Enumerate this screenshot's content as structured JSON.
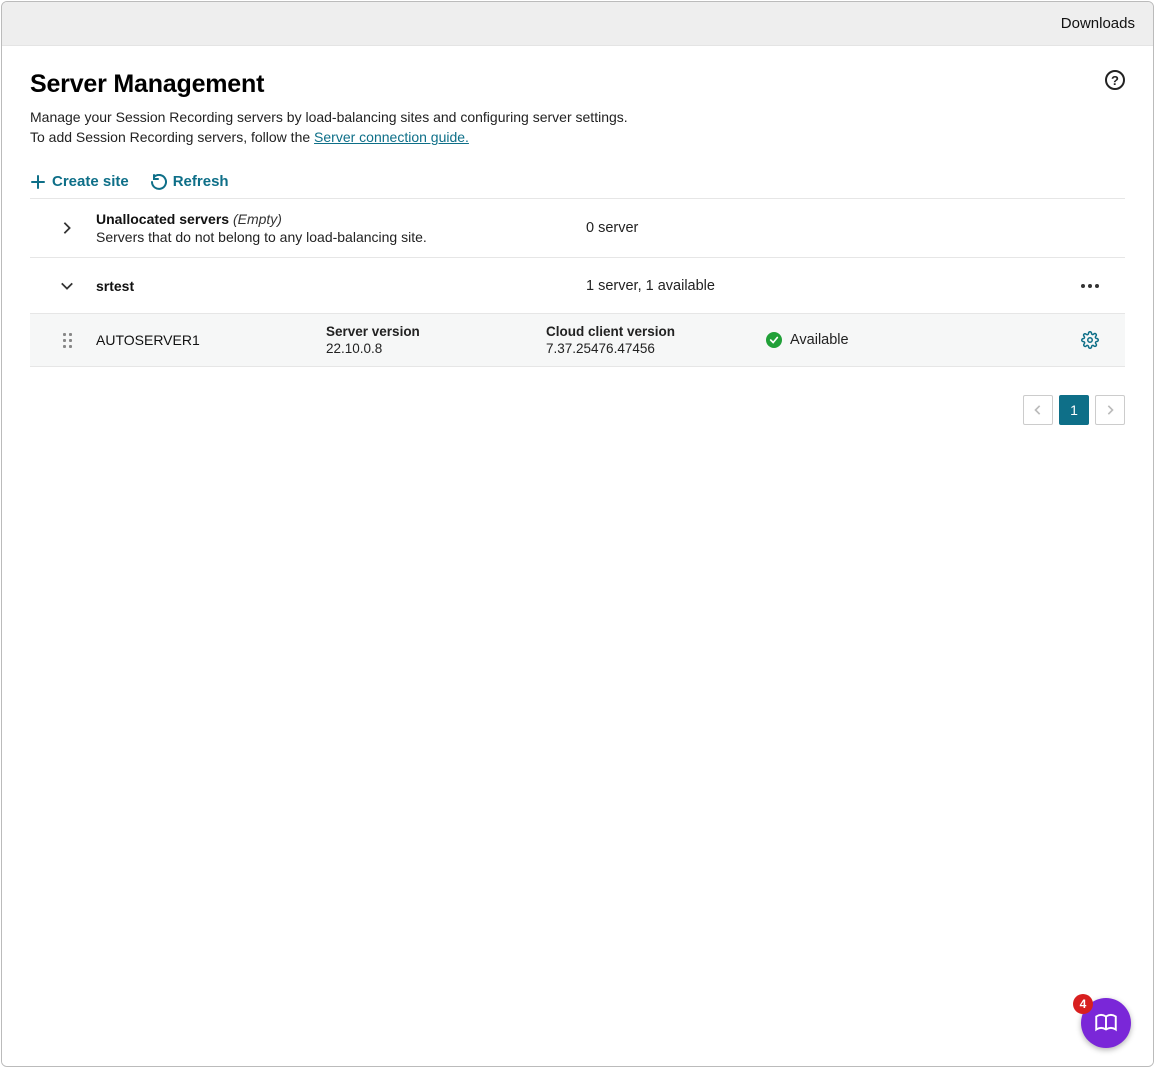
{
  "topbar": {
    "downloads": "Downloads"
  },
  "header": {
    "title": "Server Management",
    "desc1": "Manage your Session Recording servers by load-balancing sites and configuring server settings.",
    "desc2_prefix": "To add Session Recording servers, follow the  ",
    "guide_link": "Server connection guide."
  },
  "actions": {
    "create_site": "Create site",
    "refresh": "Refresh"
  },
  "sites": [
    {
      "title": "Unallocated servers",
      "empty_suffix": "(Empty)",
      "subtitle": "Servers that do not belong to any load-balancing site.",
      "count_text": "0 server",
      "expanded": false,
      "has_menu": false
    },
    {
      "title": "srtest",
      "empty_suffix": "",
      "subtitle": "",
      "count_text": "1 server, 1 available",
      "expanded": true,
      "has_menu": true
    }
  ],
  "server": {
    "name": "AUTOSERVER1",
    "version_label": "Server version",
    "version_value": "22.10.0.8",
    "cloud_label": "Cloud client version",
    "cloud_value": "7.37.25476.47456",
    "status": "Available"
  },
  "pagination": {
    "current": "1"
  },
  "fab": {
    "badge": "4"
  }
}
